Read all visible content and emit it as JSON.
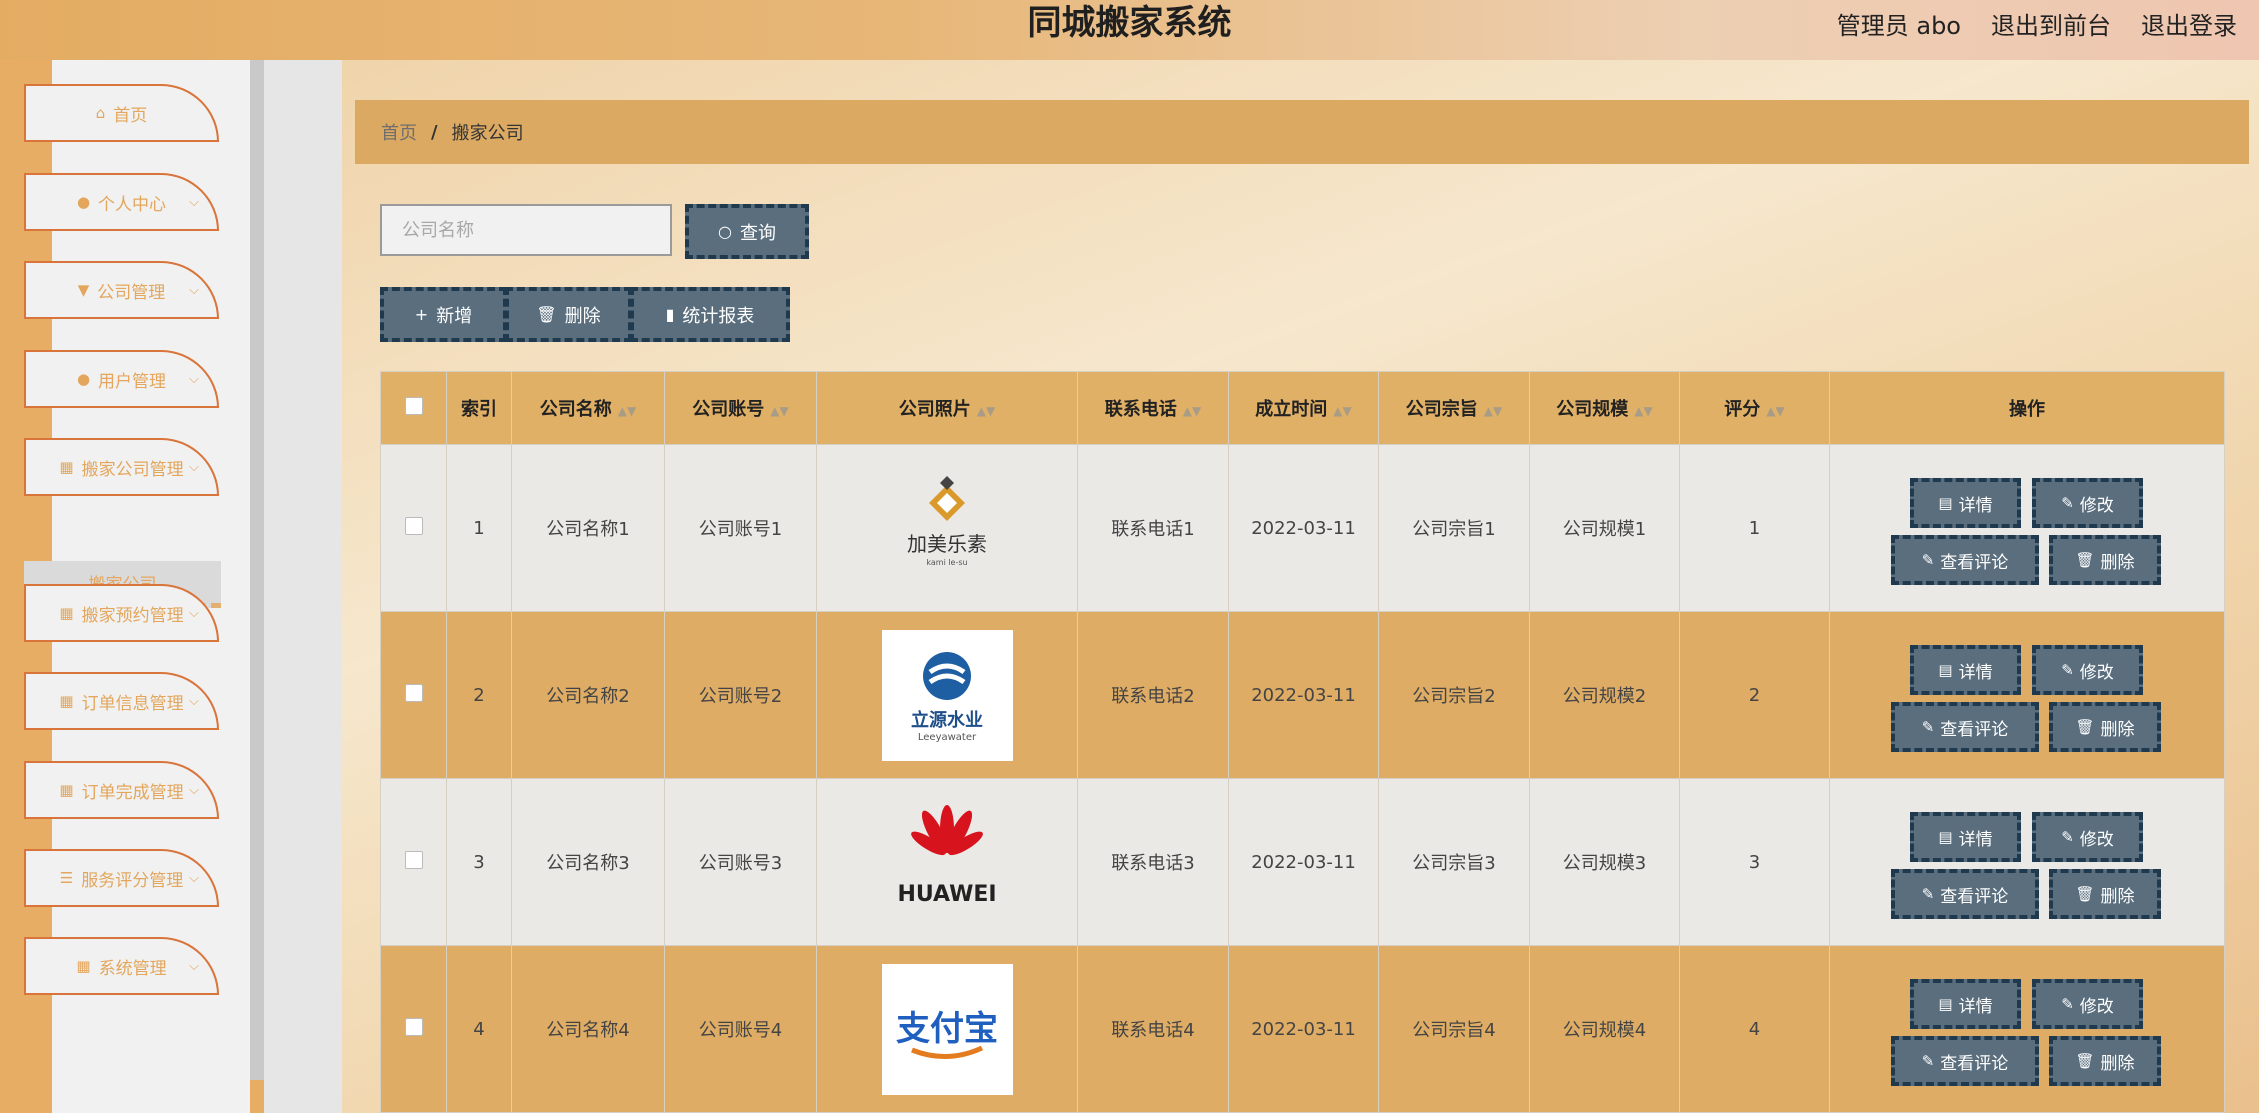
{
  "header": {
    "title": "同城搬家系统",
    "admin_label": "管理员 abo",
    "to_front": "退出到前台",
    "logout": "退出登录"
  },
  "sidebar": {
    "items": [
      {
        "label": "首页",
        "icon": "home-icon"
      },
      {
        "label": "个人中心",
        "icon": "user-icon"
      },
      {
        "label": "公司管理",
        "icon": "brush-icon"
      },
      {
        "label": "用户管理",
        "icon": "lightbulb-icon"
      },
      {
        "label": "搬家公司管理",
        "icon": "grid-icon"
      },
      {
        "label": "搬家预约管理",
        "icon": "grid-icon"
      },
      {
        "label": "订单信息管理",
        "icon": "grid-icon"
      },
      {
        "label": "订单完成管理",
        "icon": "grid-icon"
      },
      {
        "label": "服务评分管理",
        "icon": "list-icon"
      },
      {
        "label": "系统管理",
        "icon": "grid-icon"
      }
    ],
    "active_sub": "搬家公司"
  },
  "breadcrumb": {
    "home": "首页",
    "separator": "/",
    "current": "搬家公司"
  },
  "search": {
    "placeholder": "公司名称",
    "value": "",
    "button": "查询"
  },
  "toolbar": {
    "add": "新增",
    "delete": "删除",
    "report": "统计报表"
  },
  "table": {
    "columns": [
      "索引",
      "公司名称",
      "公司账号",
      "公司照片",
      "联系电话",
      "成立时间",
      "公司宗旨",
      "公司规模",
      "评分",
      "操作"
    ],
    "rows": [
      {
        "index": "1",
        "name": "公司名称1",
        "account": "公司账号1",
        "logo": "jiameileshu",
        "logo_text": "加美乐素",
        "logo_sub": "kami le-su",
        "phone": "联系电话1",
        "date": "2022-03-11",
        "mission": "公司宗旨1",
        "scale": "公司规模1",
        "rating": "1"
      },
      {
        "index": "2",
        "name": "公司名称2",
        "account": "公司账号2",
        "logo": "liyuanshuiye",
        "logo_text": "立源水业",
        "logo_sub": "Leeyawater",
        "phone": "联系电话2",
        "date": "2022-03-11",
        "mission": "公司宗旨2",
        "scale": "公司规模2",
        "rating": "2"
      },
      {
        "index": "3",
        "name": "公司名称3",
        "account": "公司账号3",
        "logo": "huawei",
        "logo_text": "HUAWEI",
        "logo_sub": "",
        "phone": "联系电话3",
        "date": "2022-03-11",
        "mission": "公司宗旨3",
        "scale": "公司规模3",
        "rating": "3"
      },
      {
        "index": "4",
        "name": "公司名称4",
        "account": "公司账号4",
        "logo": "alipay",
        "logo_text": "支付宝",
        "logo_sub": "",
        "phone": "联系电话4",
        "date": "2022-03-11",
        "mission": "公司宗旨4",
        "scale": "公司规模4",
        "rating": "4"
      }
    ],
    "actions": {
      "detail": "详情",
      "edit": "修改",
      "comments": "查看评论",
      "delete": "删除"
    }
  },
  "colors": {
    "accent": "#dca962",
    "button": "#5a6e7e",
    "button_border": "#1f3a4f",
    "menu_border": "#d9743a"
  }
}
